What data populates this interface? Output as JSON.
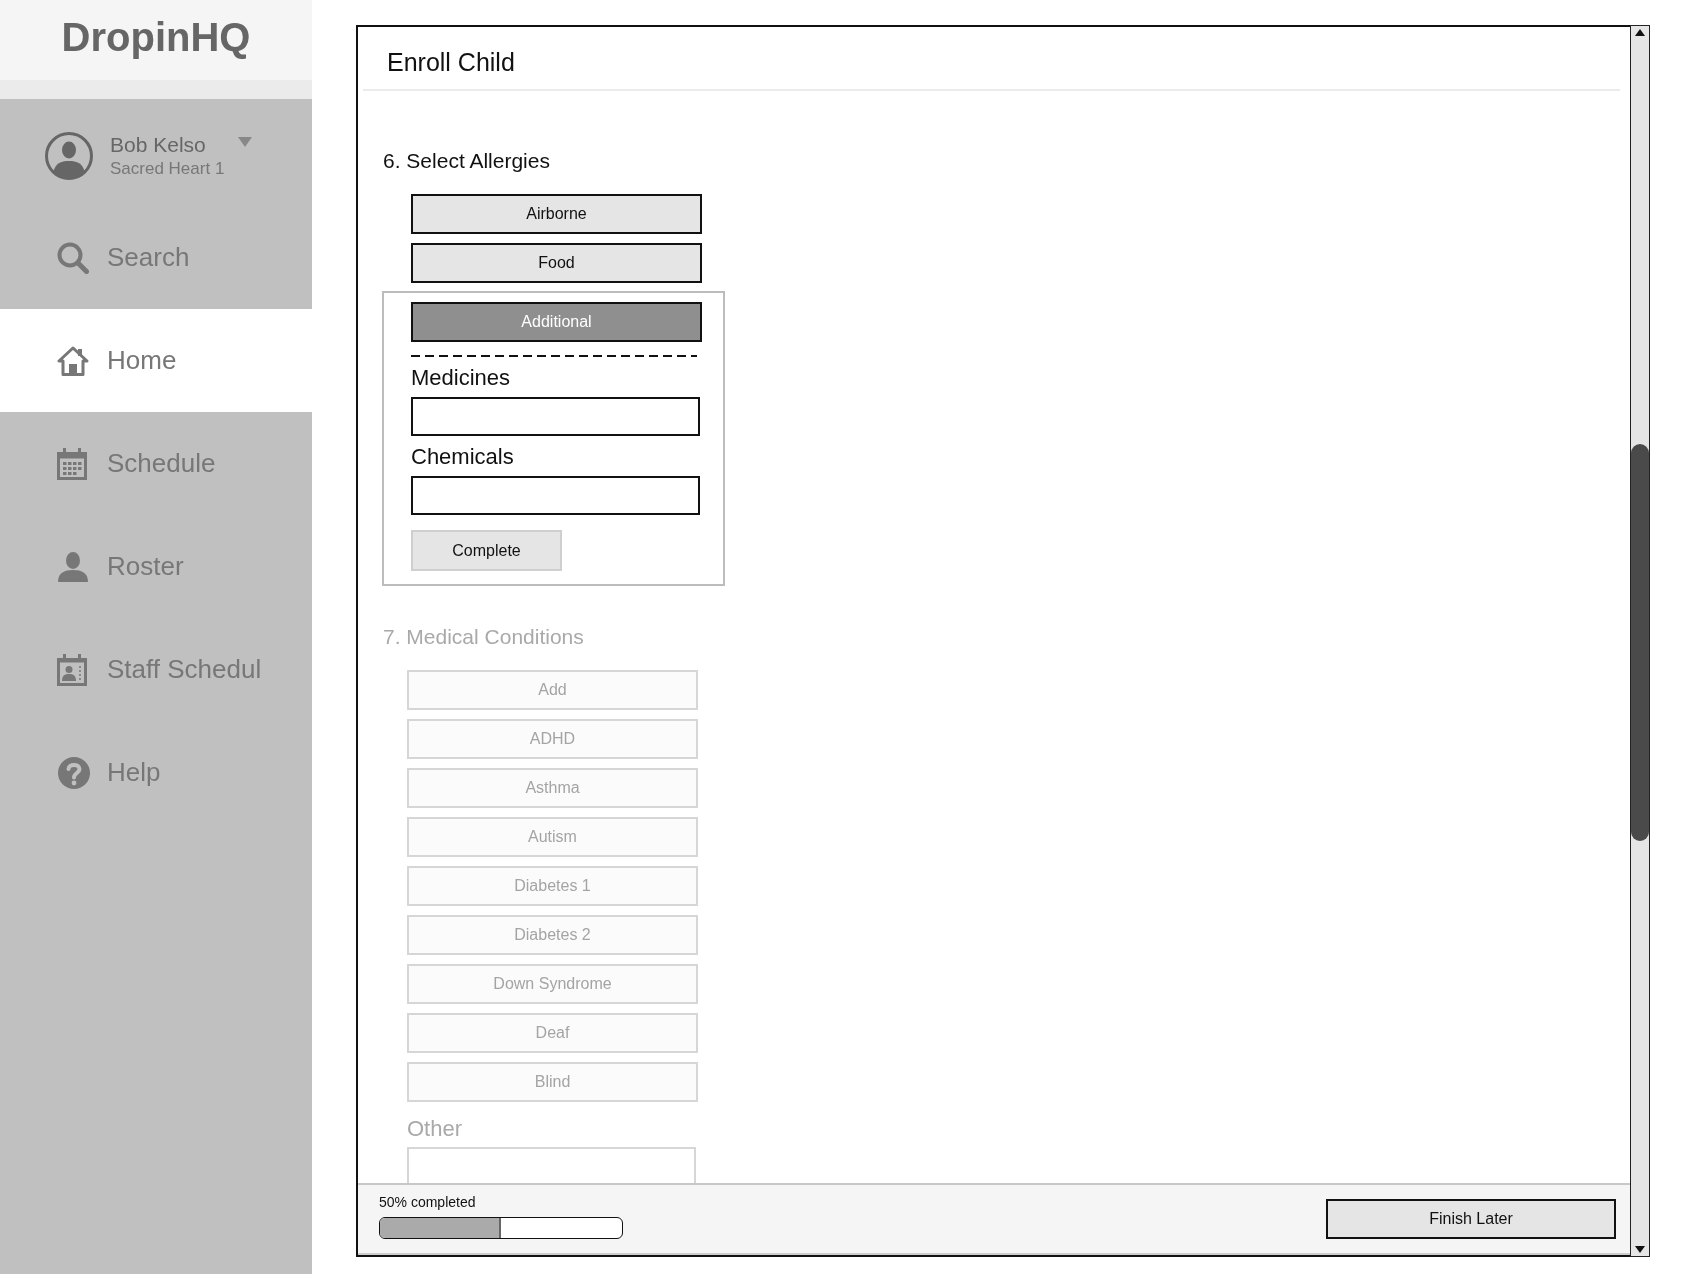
{
  "sidebar": {
    "logo": "DropinHQ",
    "user": {
      "name": "Bob Kelso",
      "subtitle": "Sacred Heart 1"
    },
    "items": [
      {
        "label": "Search",
        "selected": false
      },
      {
        "label": "Home",
        "selected": true
      },
      {
        "label": "Schedule",
        "selected": false
      },
      {
        "label": "Roster",
        "selected": false
      },
      {
        "label": "Staff Schedul",
        "selected": false
      },
      {
        "label": "Help",
        "selected": false
      }
    ]
  },
  "dialog": {
    "title": "Enroll Child",
    "sections": [
      {
        "heading": "6. Select Allergies",
        "disabled": false,
        "options": [
          {
            "label": "Airborne",
            "selected": false
          },
          {
            "label": "Food",
            "selected": false
          },
          {
            "label": "Additional",
            "selected": true
          }
        ],
        "details": {
          "fields": [
            {
              "label": "Medicines"
            },
            {
              "label": "Chemicals"
            }
          ],
          "button": "Complete"
        }
      },
      {
        "heading": "7. Medical Conditions",
        "disabled": true,
        "options": [
          {
            "label": "Add",
            "selected": false
          },
          {
            "label": "ADHD",
            "selected": false
          },
          {
            "label": "Asthma",
            "selected": false
          },
          {
            "label": "Autism",
            "selected": false
          },
          {
            "label": "Diabetes 1",
            "selected": false
          },
          {
            "label": "Diabetes 2",
            "selected": false
          },
          {
            "label": "Down Syndrome",
            "selected": false
          },
          {
            "label": "Deaf",
            "selected": false
          },
          {
            "label": "Blind",
            "selected": false
          }
        ],
        "other": {
          "label": "Other"
        }
      }
    ]
  },
  "footer": {
    "progress": {
      "label": "50% completed",
      "level": 0.5
    },
    "button": "Finish Later"
  }
}
